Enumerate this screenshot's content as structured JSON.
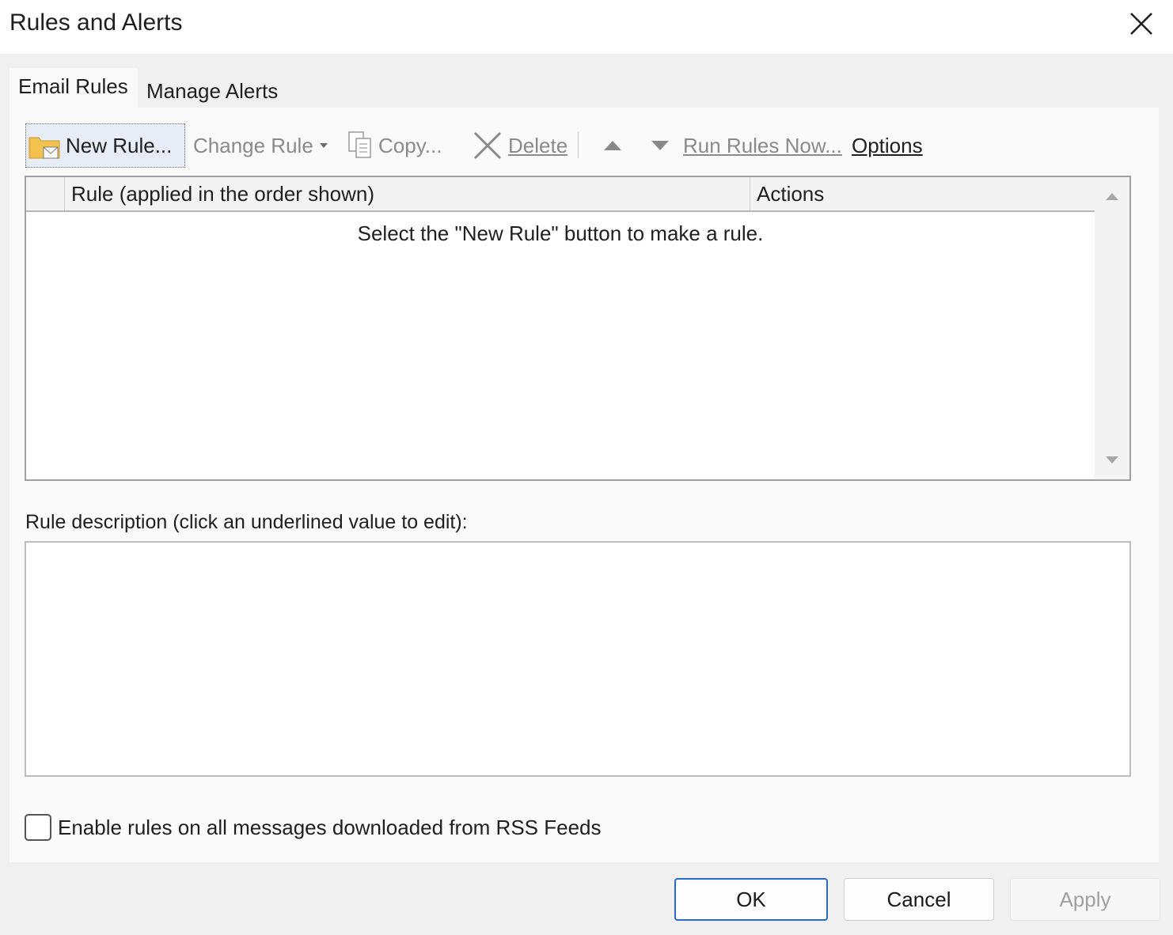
{
  "window": {
    "title": "Rules and Alerts",
    "close_icon": "close-icon"
  },
  "tabs": [
    {
      "label": "Email Rules",
      "active": true
    },
    {
      "label": "Manage Alerts",
      "active": false
    }
  ],
  "toolbar": {
    "new_rule": "New Rule...",
    "change_rule": "Change Rule",
    "copy": "Copy...",
    "delete": "Delete",
    "run_rules_now": "Run Rules Now...",
    "options": "Options"
  },
  "rules_list": {
    "columns": [
      "Rule (applied in the order shown)",
      "Actions"
    ],
    "empty_message": "Select the \"New Rule\" button to make a rule."
  },
  "description": {
    "label": "Rule description (click an underlined value to edit):",
    "text": ""
  },
  "rss": {
    "label": "Enable rules on all messages downloaded from RSS Feeds",
    "checked": false
  },
  "buttons": {
    "ok": "OK",
    "cancel": "Cancel",
    "apply": "Apply"
  },
  "colors": {
    "accent": "#2a6cc4",
    "disabled_text": "#8a8a8a",
    "folder": "#f2c14e"
  }
}
